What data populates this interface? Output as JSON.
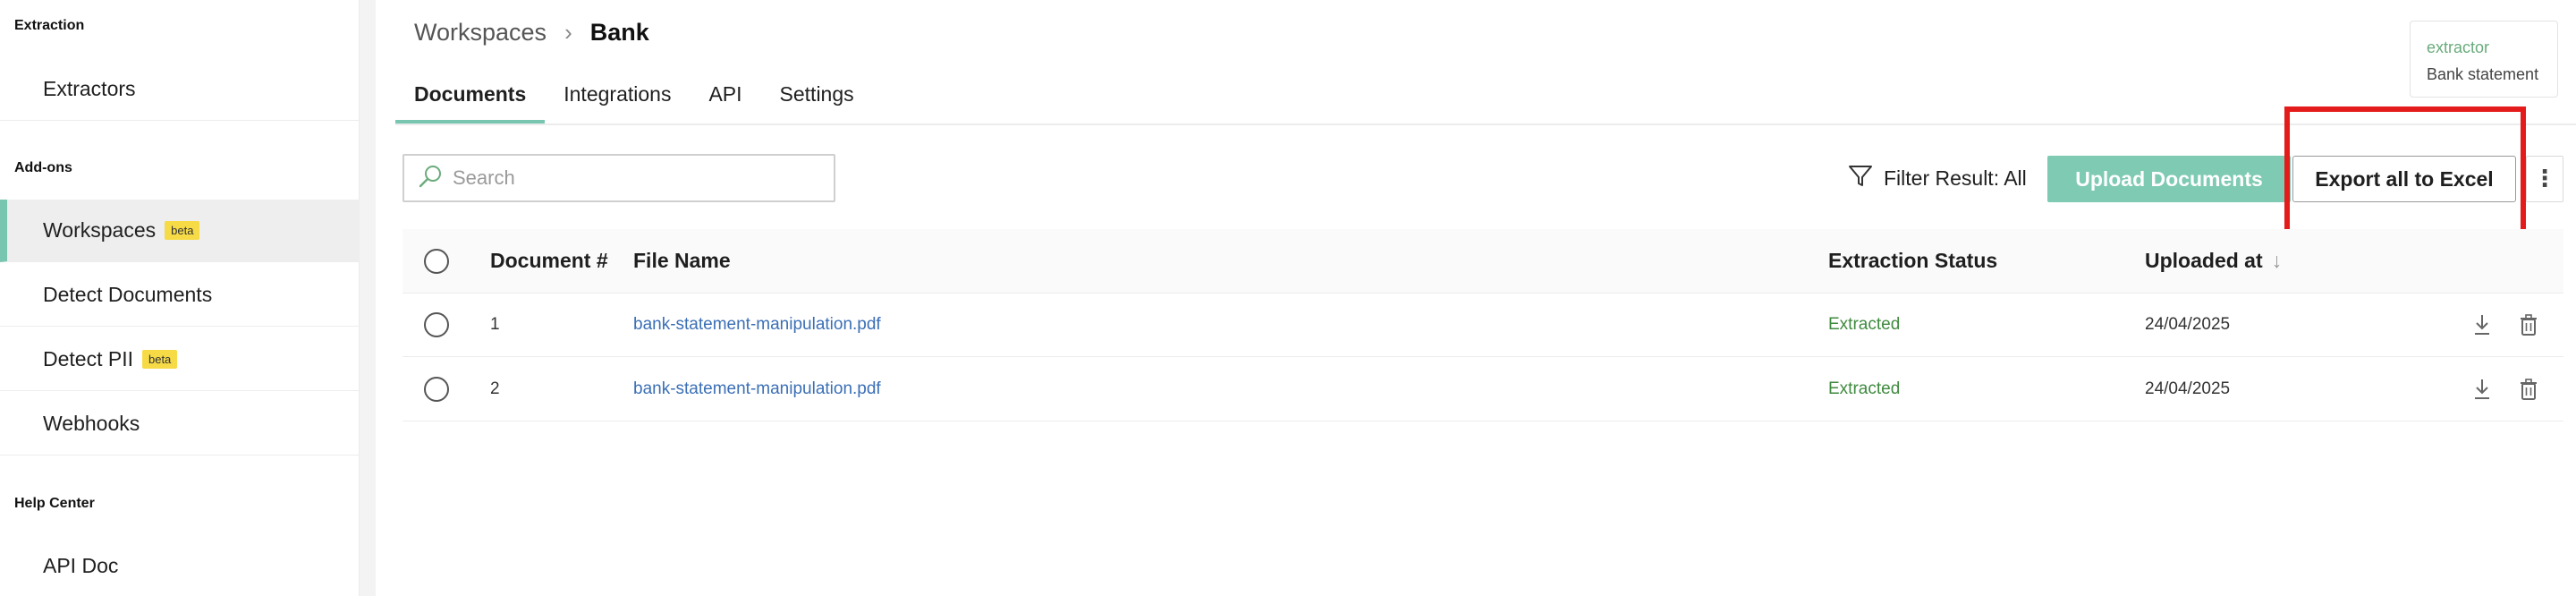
{
  "sidebar": {
    "sections": [
      {
        "title": "Extraction",
        "items": [
          {
            "label": "Extractors",
            "badge": ""
          }
        ]
      },
      {
        "title": "Add-ons",
        "items": [
          {
            "label": "Workspaces",
            "badge": "beta",
            "active": true
          },
          {
            "label": "Detect Documents",
            "badge": ""
          },
          {
            "label": "Detect PII",
            "badge": "beta"
          },
          {
            "label": "Webhooks",
            "badge": ""
          }
        ]
      },
      {
        "title": "Help Center",
        "items": [
          {
            "label": "API Doc",
            "badge": ""
          }
        ]
      }
    ]
  },
  "breadcrumb": {
    "root": "Workspaces",
    "separator": "›",
    "current": "Bank"
  },
  "tabs": [
    {
      "label": "Documents",
      "active": true
    },
    {
      "label": "Integrations"
    },
    {
      "label": "API"
    },
    {
      "label": "Settings"
    }
  ],
  "info_card": {
    "type": "extractor",
    "name": "Bank statement"
  },
  "toolbar": {
    "search_placeholder": "Search",
    "filter_label": "Filter Result: All",
    "upload_label": "Upload Documents",
    "export_label": "Export all to Excel",
    "more_label": "⋮"
  },
  "table": {
    "columns": [
      "Document #",
      "File Name",
      "Extraction Status",
      "Uploaded at"
    ],
    "sort_indicator": "↓",
    "rows": [
      {
        "number": "1",
        "file": "bank-statement-manipulation.pdf",
        "status": "Extracted",
        "uploaded": "24/04/2025"
      },
      {
        "number": "2",
        "file": "bank-statement-manipulation.pdf",
        "status": "Extracted",
        "uploaded": "24/04/2025"
      }
    ]
  },
  "colors": {
    "accent": "#79c6b0",
    "upload_button": "#7ecab2",
    "badge": "#f6db47",
    "link": "#3b6fb6",
    "status_extracted": "#3f8a3f",
    "annotation": "#e41b1b"
  },
  "icons": [
    "search-icon",
    "filter-icon",
    "chevron-right-icon",
    "download-icon",
    "trash-icon",
    "kebab-menu-icon",
    "sort-arrow-icon"
  ]
}
